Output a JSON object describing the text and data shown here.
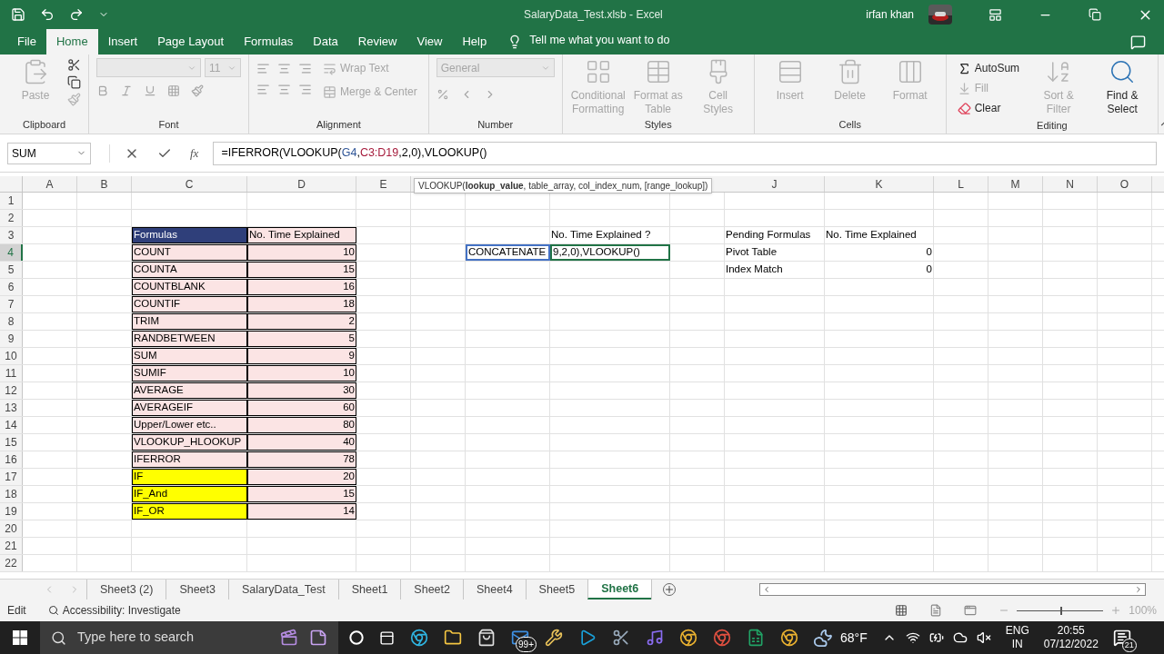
{
  "title_bar": {
    "title": "SalaryData_Test.xlsb  -  Excel",
    "user": "irfan khan"
  },
  "tabs": [
    {
      "label": "File",
      "selected": false
    },
    {
      "label": "Home",
      "selected": true
    },
    {
      "label": "Insert",
      "selected": false
    },
    {
      "label": "Page Layout",
      "selected": false
    },
    {
      "label": "Formulas",
      "selected": false
    },
    {
      "label": "Data",
      "selected": false
    },
    {
      "label": "Review",
      "selected": false
    },
    {
      "label": "View",
      "selected": false
    },
    {
      "label": "Help",
      "selected": false
    }
  ],
  "tell_me": "Tell me what you want to do",
  "ribbon": [
    {
      "label": "Clipboard",
      "items": [
        {
          "kind": "large",
          "label": "Paste",
          "disabled": true
        }
      ]
    },
    {
      "label": "Font",
      "items": [
        {
          "kind": "combo",
          "disabled": true
        },
        {
          "kind": "combo",
          "value": "11",
          "disabled": true
        }
      ]
    },
    {
      "label": "Alignment",
      "items": [
        {
          "kind": "small",
          "label": "Wrap Text",
          "disabled": true
        },
        {
          "kind": "small",
          "label": "Merge & Center",
          "disabled": true
        }
      ]
    },
    {
      "label": "Number",
      "items": [
        {
          "kind": "combo",
          "value": "General",
          "disabled": true
        }
      ]
    },
    {
      "label": "Styles",
      "items": [
        {
          "kind": "large",
          "label": "Conditional Formatting",
          "disabled": true
        },
        {
          "kind": "large",
          "label": "Format as Table",
          "disabled": true
        },
        {
          "kind": "large",
          "label": "Cell Styles",
          "disabled": true
        }
      ]
    },
    {
      "label": "Cells",
      "items": [
        {
          "kind": "large",
          "label": "Insert",
          "disabled": true
        },
        {
          "kind": "large",
          "label": "Delete",
          "disabled": true
        },
        {
          "kind": "large",
          "label": "Format",
          "disabled": true
        }
      ]
    },
    {
      "label": "Editing",
      "items": [
        {
          "kind": "small",
          "label": "AutoSum",
          "disabled": false
        },
        {
          "kind": "small",
          "label": "Fill",
          "disabled": true
        },
        {
          "kind": "small",
          "label": "Clear",
          "disabled": false
        },
        {
          "kind": "large",
          "label": "Sort & Filter",
          "disabled": true
        },
        {
          "kind": "large",
          "label": "Find & Select",
          "disabled": false
        }
      ]
    }
  ],
  "formula_bar": {
    "name_box": "SUM",
    "fx": "fx",
    "parts": [
      {
        "text": "=IFERROR(VLOOKUP("
      },
      {
        "text": "G4",
        "color": "#2f5597"
      },
      {
        "text": ","
      },
      {
        "text": "C3:D19",
        "color": "#a61c3c"
      },
      {
        "text": ",2,0),VLOOKUP()"
      }
    ]
  },
  "tooltip": "VLOOKUP(**lookup_value**, table_array, col_index_num, [range_lookup])",
  "columns_left": [
    "A",
    "B",
    "C",
    "D",
    "E"
  ],
  "columns_right": [
    "J",
    "K",
    "L",
    "M",
    "N",
    "O"
  ],
  "row_numbers": [
    {
      "label": "1",
      "selected": false
    },
    {
      "label": "2",
      "selected": false
    },
    {
      "label": "3",
      "selected": false
    },
    {
      "label": "4",
      "selected": true
    },
    {
      "label": "5",
      "selected": false
    },
    {
      "label": "6",
      "selected": false
    },
    {
      "label": "7",
      "selected": false
    },
    {
      "label": "8",
      "selected": false
    },
    {
      "label": "9",
      "selected": false
    },
    {
      "label": "10",
      "selected": false
    },
    {
      "label": "11",
      "selected": false
    },
    {
      "label": "12",
      "selected": false
    },
    {
      "label": "13",
      "selected": false
    },
    {
      "label": "14",
      "selected": false
    },
    {
      "label": "15",
      "selected": false
    },
    {
      "label": "16",
      "selected": false
    },
    {
      "label": "17",
      "selected": false
    },
    {
      "label": "18",
      "selected": false
    },
    {
      "label": "19",
      "selected": false
    },
    {
      "label": "20",
      "selected": false
    },
    {
      "label": "21",
      "selected": false
    },
    {
      "label": "22",
      "selected": false
    }
  ],
  "formula_table": {
    "columns": [
      "Formulas",
      "No. Time Explained"
    ],
    "rows": [
      {
        "formula": "COUNT",
        "count": "10",
        "color": "#fbe4e4"
      },
      {
        "formula": "COUNTA",
        "count": "15",
        "color": "#fbe4e4"
      },
      {
        "formula": "COUNTBLANK",
        "count": "16",
        "color": "#fbe4e4"
      },
      {
        "formula": "COUNTIF",
        "count": "18",
        "color": "#fbe4e4"
      },
      {
        "formula": "TRIM",
        "count": "2",
        "color": "#fbe4e4"
      },
      {
        "formula": "RANDBETWEEN",
        "count": "5",
        "color": "#fbe4e4"
      },
      {
        "formula": "SUM",
        "count": "9",
        "color": "#fbe4e4"
      },
      {
        "formula": "SUMIF",
        "count": "10",
        "color": "#fbe4e4"
      },
      {
        "formula": "AVERAGE",
        "count": "30",
        "color": "#fbe4e4"
      },
      {
        "formula": "AVERAGEIF",
        "count": "60",
        "color": "#fbe4e4"
      },
      {
        "formula": "Upper/Lower etc..",
        "count": "80",
        "color": "#fbe4e4"
      },
      {
        "formula": "VLOOKUP_HLOOKUP",
        "count": "40",
        "color": "#fbe4e4"
      },
      {
        "formula": "IFERROR",
        "count": "78",
        "color": "#fbe4e4"
      },
      {
        "formula": "IF",
        "count": "20",
        "color": "#ffff00"
      },
      {
        "formula": "IF_And",
        "count": "15",
        "color": "#ffff00"
      },
      {
        "formula": "IF_OR",
        "count": "14",
        "color": "#ffff00"
      }
    ]
  },
  "lookup": {
    "header": "No. Time Explained ?",
    "input": "CONCATENATE",
    "editing": "9,2,0),VLOOKUP()"
  },
  "pending_table": {
    "columns": [
      "Pending Formulas",
      "No. Time Explained"
    ],
    "rows": [
      {
        "formula": "Pivot Table",
        "count": "0"
      },
      {
        "formula": "Index Match",
        "count": "0"
      }
    ]
  },
  "sheets": [
    {
      "label": "Sheet3 (2)",
      "selected": false
    },
    {
      "label": "Sheet3",
      "selected": false
    },
    {
      "label": "SalaryData_Test",
      "selected": false
    },
    {
      "label": "Sheet1",
      "selected": false
    },
    {
      "label": "Sheet2",
      "selected": false
    },
    {
      "label": "Sheet4",
      "selected": false
    },
    {
      "label": "Sheet5",
      "selected": false
    },
    {
      "label": "Sheet6",
      "selected": true
    }
  ],
  "status_bar": {
    "mode": "Edit",
    "accessibility": "Accessibility: Investigate",
    "zoom": {
      "level": 0.5,
      "reading": "100%"
    }
  },
  "taskbar": {
    "search_placeholder": "Type here to search",
    "mail_badge": "99+",
    "temperature": "68°F",
    "language": "ENG",
    "region": "IN",
    "time": "20:55",
    "date": "07/12/2022",
    "notifications": "21"
  }
}
